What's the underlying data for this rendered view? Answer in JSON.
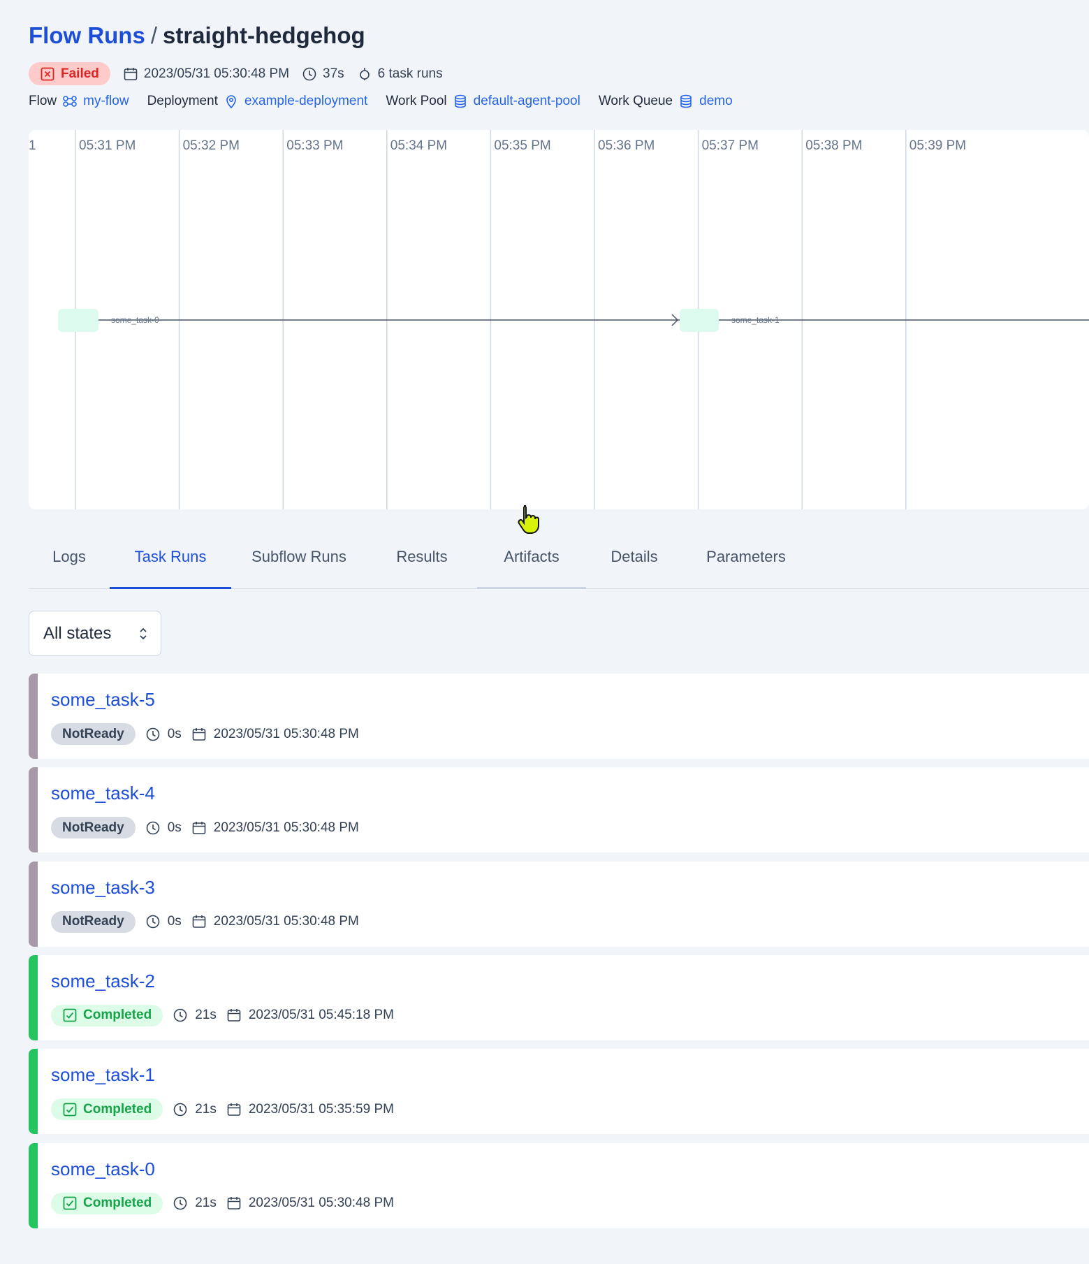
{
  "header": {
    "breadcrumb_root": "Flow Runs",
    "breadcrumb_sep": "/",
    "run_name": "straight-hedgehog",
    "state": "Failed",
    "start_time": "2023/05/31 05:30:48 PM",
    "duration": "37s",
    "task_runs_count": "6 task runs"
  },
  "relations": {
    "flow_label": "Flow",
    "flow_value": "my-flow",
    "deployment_label": "Deployment",
    "deployment_value": "example-deployment",
    "work_pool_label": "Work Pool",
    "work_pool_value": "default-agent-pool",
    "work_queue_label": "Work Queue",
    "work_queue_value": "demo"
  },
  "timeline": {
    "ticks": [
      "05:31 PM",
      "05:32 PM",
      "05:33 PM",
      "05:34 PM",
      "05:35 PM",
      "05:36 PM",
      "05:37 PM",
      "05:38 PM",
      "05:39 PM"
    ],
    "nodes": [
      "some_task-0",
      "some_task-1"
    ]
  },
  "tabs": [
    {
      "label": "Logs"
    },
    {
      "label": "Task Runs"
    },
    {
      "label": "Subflow Runs"
    },
    {
      "label": "Results"
    },
    {
      "label": "Artifacts"
    },
    {
      "label": "Details"
    },
    {
      "label": "Parameters"
    }
  ],
  "filter": {
    "selected": "All states"
  },
  "tasks": [
    {
      "name": "some_task-5",
      "state": "NotReady",
      "duration": "0s",
      "time": "2023/05/31 05:30:48 PM"
    },
    {
      "name": "some_task-4",
      "state": "NotReady",
      "duration": "0s",
      "time": "2023/05/31 05:30:48 PM"
    },
    {
      "name": "some_task-3",
      "state": "NotReady",
      "duration": "0s",
      "time": "2023/05/31 05:30:48 PM"
    },
    {
      "name": "some_task-2",
      "state": "Completed",
      "duration": "21s",
      "time": "2023/05/31 05:45:18 PM"
    },
    {
      "name": "some_task-1",
      "state": "Completed",
      "duration": "21s",
      "time": "2023/05/31 05:35:59 PM"
    },
    {
      "name": "some_task-0",
      "state": "Completed",
      "duration": "21s",
      "time": "2023/05/31 05:30:48 PM"
    }
  ],
  "colors": {
    "accent": "#1d4ed8",
    "failed_bg": "#fecaca",
    "failed_fg": "#dc2626",
    "completed_bar": "#22c55e",
    "notready_bar": "#a69aa8"
  }
}
